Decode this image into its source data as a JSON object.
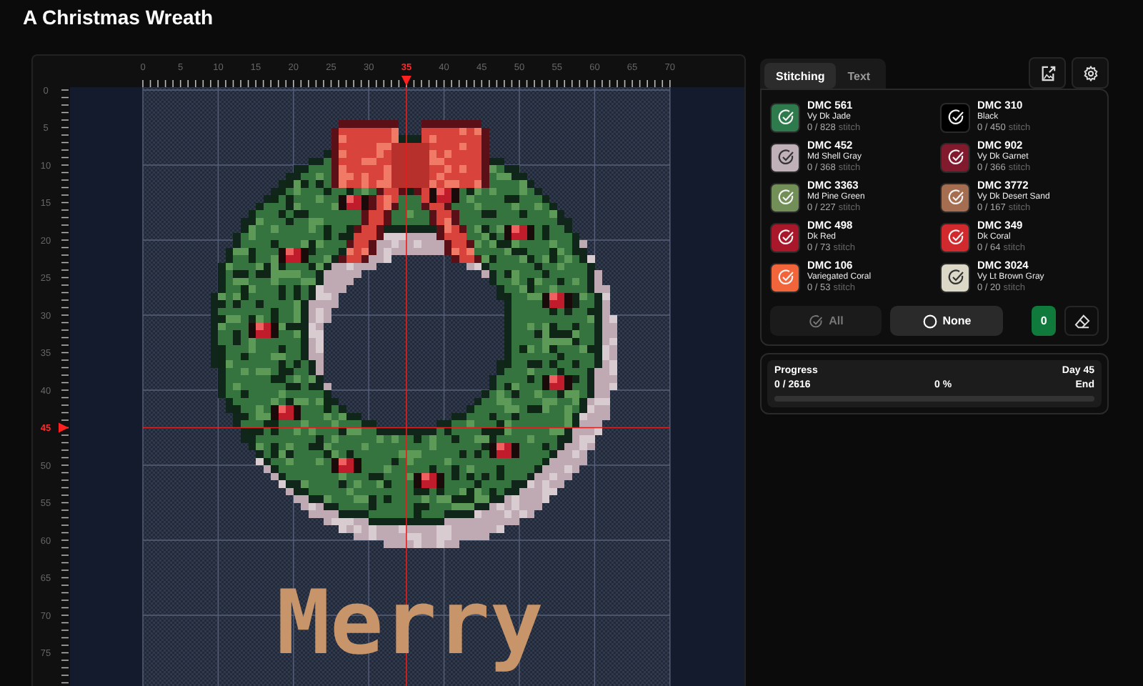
{
  "title": "A Christmas Wreath",
  "canvas": {
    "top_ruler": [
      {
        "label": "0",
        "selected": false
      },
      {
        "label": "5",
        "selected": false
      },
      {
        "label": "10",
        "selected": false
      },
      {
        "label": "15",
        "selected": false
      },
      {
        "label": "20",
        "selected": false
      },
      {
        "label": "25",
        "selected": false
      },
      {
        "label": "30",
        "selected": false
      },
      {
        "label": "35",
        "selected": true
      },
      {
        "label": "40",
        "selected": false
      },
      {
        "label": "45",
        "selected": false
      },
      {
        "label": "50",
        "selected": false
      },
      {
        "label": "55",
        "selected": false
      },
      {
        "label": "60",
        "selected": false
      },
      {
        "label": "65",
        "selected": false
      },
      {
        "label": "70",
        "selected": false
      }
    ],
    "left_ruler": [
      {
        "label": "0",
        "selected": false
      },
      {
        "label": "5",
        "selected": false
      },
      {
        "label": "10",
        "selected": false
      },
      {
        "label": "15",
        "selected": false
      },
      {
        "label": "20",
        "selected": false
      },
      {
        "label": "25",
        "selected": false
      },
      {
        "label": "30",
        "selected": false
      },
      {
        "label": "35",
        "selected": false
      },
      {
        "label": "40",
        "selected": false
      },
      {
        "label": "45",
        "selected": true
      },
      {
        "label": "50",
        "selected": false
      },
      {
        "label": "55",
        "selected": false
      },
      {
        "label": "60",
        "selected": false
      },
      {
        "label": "65",
        "selected": false
      },
      {
        "label": "70",
        "selected": false
      },
      {
        "label": "75",
        "selected": false
      }
    ],
    "pattern_text": "Merry"
  },
  "panel": {
    "tabs": [
      {
        "label": "Stitching",
        "selected": true
      },
      {
        "label": "Text",
        "selected": false
      }
    ],
    "threads": [
      {
        "code": "DMC 561",
        "name": "Vy Dk Jade",
        "count": "0 / 828",
        "unit": "stitch",
        "color": "#2f7a4c",
        "selected": true
      },
      {
        "code": "DMC 310",
        "name": "Black",
        "count": "0 / 450",
        "unit": "stitch",
        "color": "#000000",
        "selected": true
      },
      {
        "code": "DMC 452",
        "name": "Md Shell Gray",
        "count": "0 / 368",
        "unit": "stitch",
        "color": "#c0b0b8",
        "selected": true
      },
      {
        "code": "DMC 902",
        "name": "Vy Dk Garnet",
        "count": "0 / 366",
        "unit": "stitch",
        "color": "#821a2e",
        "selected": true
      },
      {
        "code": "DMC 3363",
        "name": "Md Pine Green",
        "count": "0 / 227",
        "unit": "stitch",
        "color": "#728f58",
        "selected": true
      },
      {
        "code": "DMC 3772",
        "name": "Vy Dk Desert Sand",
        "count": "0 / 167",
        "unit": "stitch",
        "color": "#a66e50",
        "selected": true
      },
      {
        "code": "DMC 498",
        "name": "Dk Red",
        "count": "0 / 73",
        "unit": "stitch",
        "color": "#a8182a",
        "selected": true
      },
      {
        "code": "DMC 349",
        "name": "Dk Coral",
        "count": "0 / 64",
        "unit": "stitch",
        "color": "#d02a2e",
        "selected": true
      },
      {
        "code": "DMC 106",
        "name": "Variegated Coral",
        "count": "0 / 53",
        "unit": "stitch",
        "color": "#f2643a",
        "selected": true
      },
      {
        "code": "DMC 3024",
        "name": "Vy Lt Brown Gray",
        "count": "0 / 20",
        "unit": "stitch",
        "color": "#dcd8c8",
        "selected": true
      }
    ],
    "buttons": [
      {
        "label": "All",
        "disabled": true
      },
      {
        "label": "None",
        "disabled": false
      }
    ],
    "counter": "0",
    "progress": {
      "label": "Progress",
      "day": "Day 45",
      "count": "0 / 2616",
      "percent": "0 %",
      "end": "End",
      "level": 0
    }
  }
}
